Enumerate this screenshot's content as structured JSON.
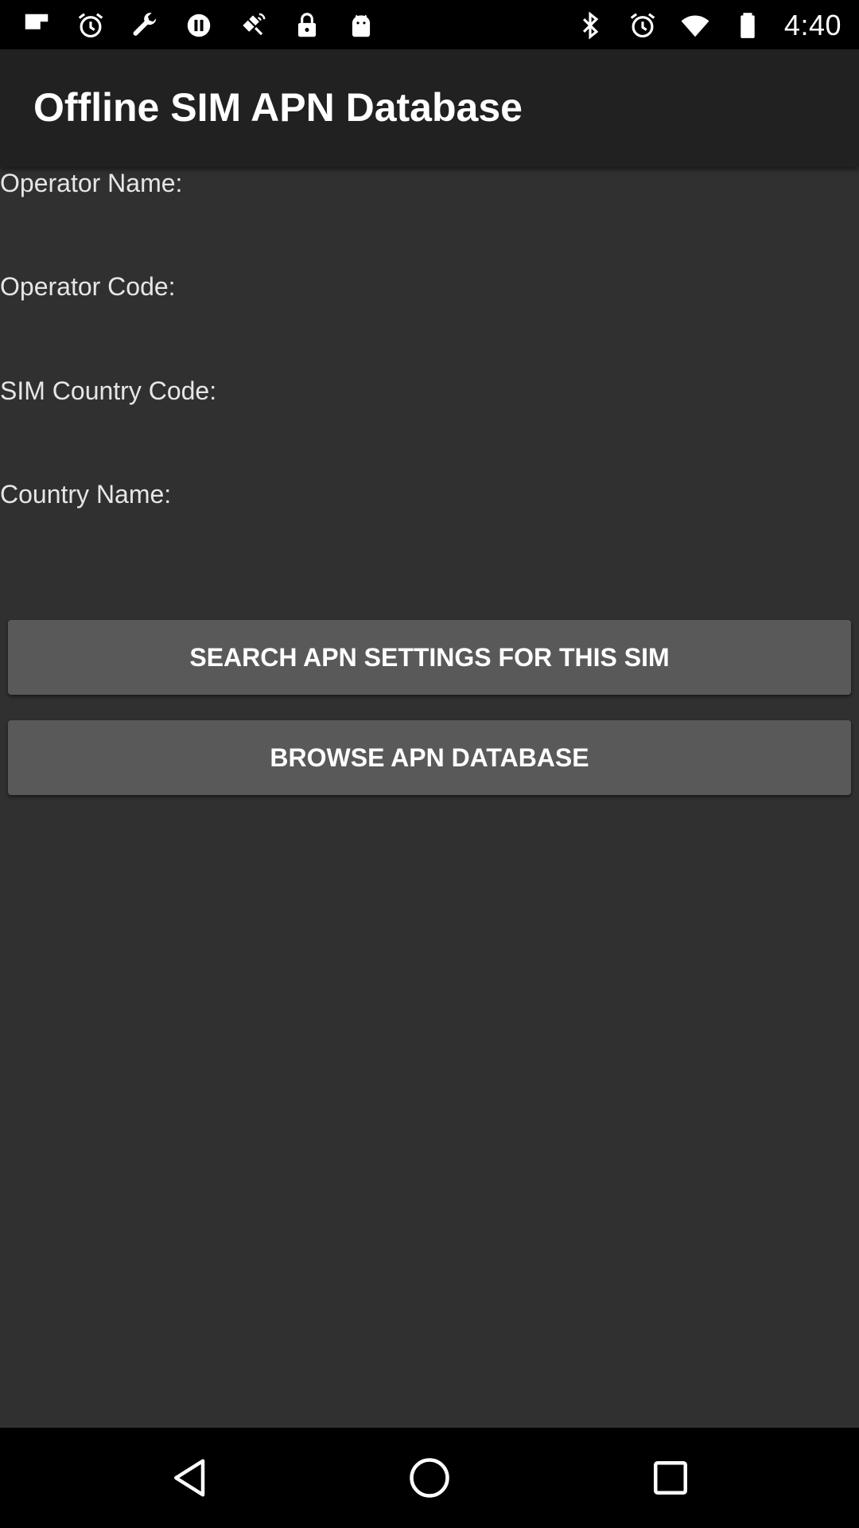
{
  "status_bar": {
    "time": "4:40",
    "left_icons": [
      "flipboard-icon",
      "alarm-icon",
      "wrench-icon",
      "pause-icon",
      "fake-gps-satellite-icon",
      "lock-icon",
      "android-icon"
    ],
    "right_icons": [
      "bluetooth-icon",
      "alarm-icon",
      "wifi-icon",
      "battery-icon"
    ]
  },
  "app_bar": {
    "title": "Offline SIM APN Database"
  },
  "fields": [
    {
      "label": "Operator Name:",
      "value": ""
    },
    {
      "label": "Operator Code:",
      "value": ""
    },
    {
      "label": "SIM Country Code:",
      "value": ""
    },
    {
      "label": "Country Name:",
      "value": ""
    }
  ],
  "buttons": {
    "search_label": "SEARCH APN SETTINGS FOR THIS SIM",
    "browse_label": "BROWSE APN DATABASE"
  },
  "nav_bar": {
    "icons": [
      "back-icon",
      "home-icon",
      "recents-icon"
    ]
  },
  "colors": {
    "app_bar": "#212121",
    "content_background": "#303030",
    "button": "#595959",
    "text": "#ffffff"
  }
}
